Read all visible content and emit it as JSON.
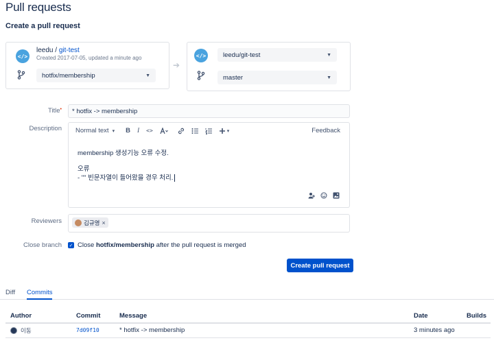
{
  "page": {
    "title": "Pull requests",
    "section": "Create a pull request"
  },
  "source": {
    "repo_owner": "leedu /",
    "repo_name": "git-test",
    "meta": "Created 2017-07-05, updated a minute ago",
    "branch": "hotfix/membership",
    "repo_icon": "</>"
  },
  "destination": {
    "repo": "leedu/git-test",
    "branch": "master",
    "repo_icon": "</>"
  },
  "arrow": "➔",
  "form": {
    "title_label": "Title",
    "title_value": "* hotfix -> membership",
    "description_label": "Description",
    "reviewers_label": "Reviewers",
    "close_branch_label": "Close branch",
    "close_branch_pre": "Close ",
    "close_branch_strong": "hotfix/membership",
    "close_branch_post": " after the pull request is merged",
    "close_branch_checked": true,
    "submit_label": "Create pull request"
  },
  "editor": {
    "text_style": "Normal text",
    "bold": "B",
    "italic": "I",
    "code": "<>",
    "feedback": "Feedback",
    "line1": "membership 생성기능 오류 수정.",
    "line2": "오류",
    "line3": "- \"\" 빈문자열이 들어왔을 경우 처리."
  },
  "reviewers": [
    {
      "name": "김규영"
    }
  ],
  "tabs": [
    {
      "label": "Diff",
      "active": false
    },
    {
      "label": "Commits",
      "active": true
    }
  ],
  "commits": {
    "columns": [
      "Author",
      "Commit",
      "Message",
      "Date",
      "Builds"
    ],
    "rows": [
      {
        "author": "이동",
        "hash": "7d09f10",
        "message": "* hotfix -> membership",
        "date": "3 minutes ago",
        "builds": ""
      }
    ]
  },
  "colors": {
    "primary": "#0052cc",
    "text": "#172b4d",
    "border": "#dfe1e6",
    "repo_icon_bg": "#4aa3df"
  },
  "icons": [
    "repo-icon",
    "branch-icon",
    "arrow-right-icon",
    "chevron-down-icon",
    "link-icon",
    "bullet-list-icon",
    "numbered-list-icon",
    "plus-icon",
    "mention-icon",
    "emoji-icon",
    "image-icon",
    "checkbox-checked-icon",
    "avatar"
  ]
}
